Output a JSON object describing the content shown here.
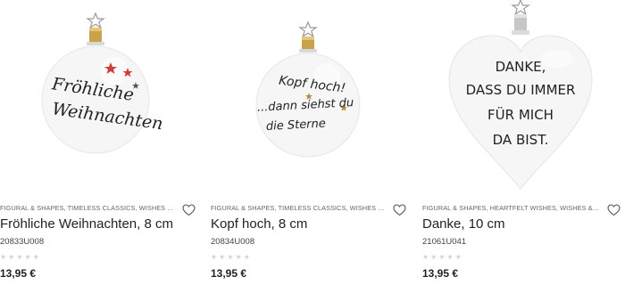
{
  "products": [
    {
      "categories": "FIGURAL & SHAPES, TIMELESS CLASSICS, WISHES & SAYI...",
      "title": "Fröhliche Weihnachten, 8 cm",
      "sku": "20833U008",
      "rating_stars": "★★★★★",
      "rating": 0,
      "price": "13,95 €",
      "ornament_text": [
        "Fröhliche",
        "Weihnachten"
      ],
      "ornament_shape": "ball",
      "wishlist_icon": "heart-outline-icon"
    },
    {
      "categories": "FIGURAL & SHAPES, TIMELESS CLASSICS, WISHES & SAYI...",
      "title": "Kopf hoch, 8 cm",
      "sku": "20834U008",
      "rating_stars": "★★★★★",
      "rating": 0,
      "price": "13,95 €",
      "ornament_text": [
        "Kopf hoch!",
        "...dann siehst du",
        "die Sterne"
      ],
      "ornament_shape": "ball",
      "wishlist_icon": "heart-outline-icon"
    },
    {
      "categories": "FIGURAL & SHAPES, HEARTFELT WISHES, WISHES & SAYI...",
      "title": "Danke, 10 cm",
      "sku": "21061U041",
      "rating_stars": "★★★★★",
      "rating": 0,
      "price": "13,95 €",
      "ornament_text": [
        "DANKE,",
        "DASS DU IMMER",
        "FÜR MICH",
        "DA BIST."
      ],
      "ornament_shape": "heart",
      "wishlist_icon": "heart-outline-icon"
    }
  ],
  "colors": {
    "ornament": "#f7f7f7",
    "cap_gold": "#c9a34a",
    "star_red": "#d33a3a",
    "star_gold": "#b08a3a",
    "rating_empty": "#d4d4d4"
  }
}
